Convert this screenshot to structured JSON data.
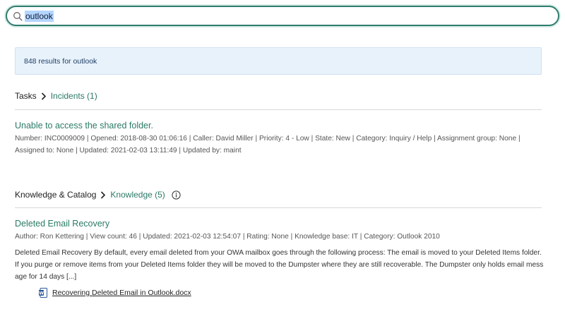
{
  "search": {
    "value": "outlook"
  },
  "results_banner": {
    "text": "848 results for outlook"
  },
  "tasks_section": {
    "category": "Tasks",
    "subcategory": "Incidents (1)",
    "result": {
      "title": "Unable to access the shared folder.",
      "meta_line1": "Number: INC0009009 | Opened: 2018-08-30 01:06:16 | Caller: David Miller | Priority: 4 - Low | State: New | Category: Inquiry / Help | Assignment group: None |",
      "meta_line2": "Assigned to: None | Updated: 2021-02-03 13:11:49 | Updated by: maint"
    }
  },
  "knowledge_section": {
    "category": "Knowledge & Catalog",
    "subcategory": "Knowledge (5)",
    "result": {
      "title": "Deleted Email Recovery",
      "meta": "Author: Ron Kettering | View count: 46 | Updated: 2021-02-03 12:54:07 | Rating: None | Knowledge base: IT | Category: Outlook 2010",
      "snippet": "Deleted Email Recovery By default, every email deleted from your OWA mailbox goes through the following process: The email is moved to your Deleted Items folder. If you purge or remove items from your Deleted Items folder they will be moved to the Dumpster where they are still recoverable. The Dumpster only holds email message for 14 days [...]",
      "attachment": "Recovering Deleted Email in Outlook.docx"
    }
  },
  "colors": {
    "accent": "#2b7a66",
    "banner_bg": "#e8f2fb",
    "search_border": "#2f7d6f"
  },
  "icons": {
    "search": "search-icon",
    "info": "info-icon",
    "chevron": "chevron-right-icon",
    "document": "word-document-icon"
  }
}
